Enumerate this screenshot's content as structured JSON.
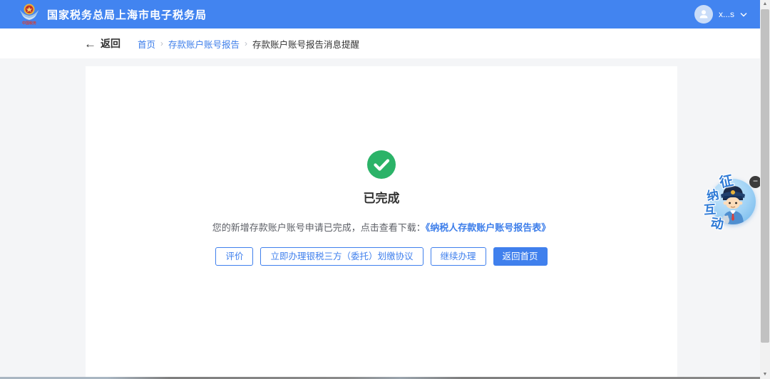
{
  "header": {
    "title": "国家税务总局上海市电子税务局",
    "user_label": "x...s"
  },
  "breadcrumb": {
    "back_label": "返回",
    "separator": "›",
    "items": [
      {
        "label": "首页"
      },
      {
        "label": "存款账户账号报告"
      },
      {
        "label": "存款账户账号报告消息提醒"
      }
    ]
  },
  "result": {
    "status_title": "已完成",
    "message_prefix": "您的新增存款账户账号申请已完成，点击查看下载：",
    "message_link": "《纳税人存款账户账号报告表》",
    "buttons": [
      {
        "label": "评价",
        "type": "outline"
      },
      {
        "label": "立即办理银税三方（委托）划缴协议",
        "type": "outline"
      },
      {
        "label": "继续办理",
        "type": "outline"
      },
      {
        "label": "返回首页",
        "type": "primary"
      }
    ]
  },
  "widget": {
    "chars": [
      "征",
      "纳",
      "互",
      "动"
    ],
    "collapse_label": "−"
  },
  "colors": {
    "header_blue": "#4284f0",
    "link_blue": "#3d7eea",
    "button_blue": "#4080ed",
    "success_green": "#2bb368",
    "page_bg": "#f4f5f7"
  }
}
